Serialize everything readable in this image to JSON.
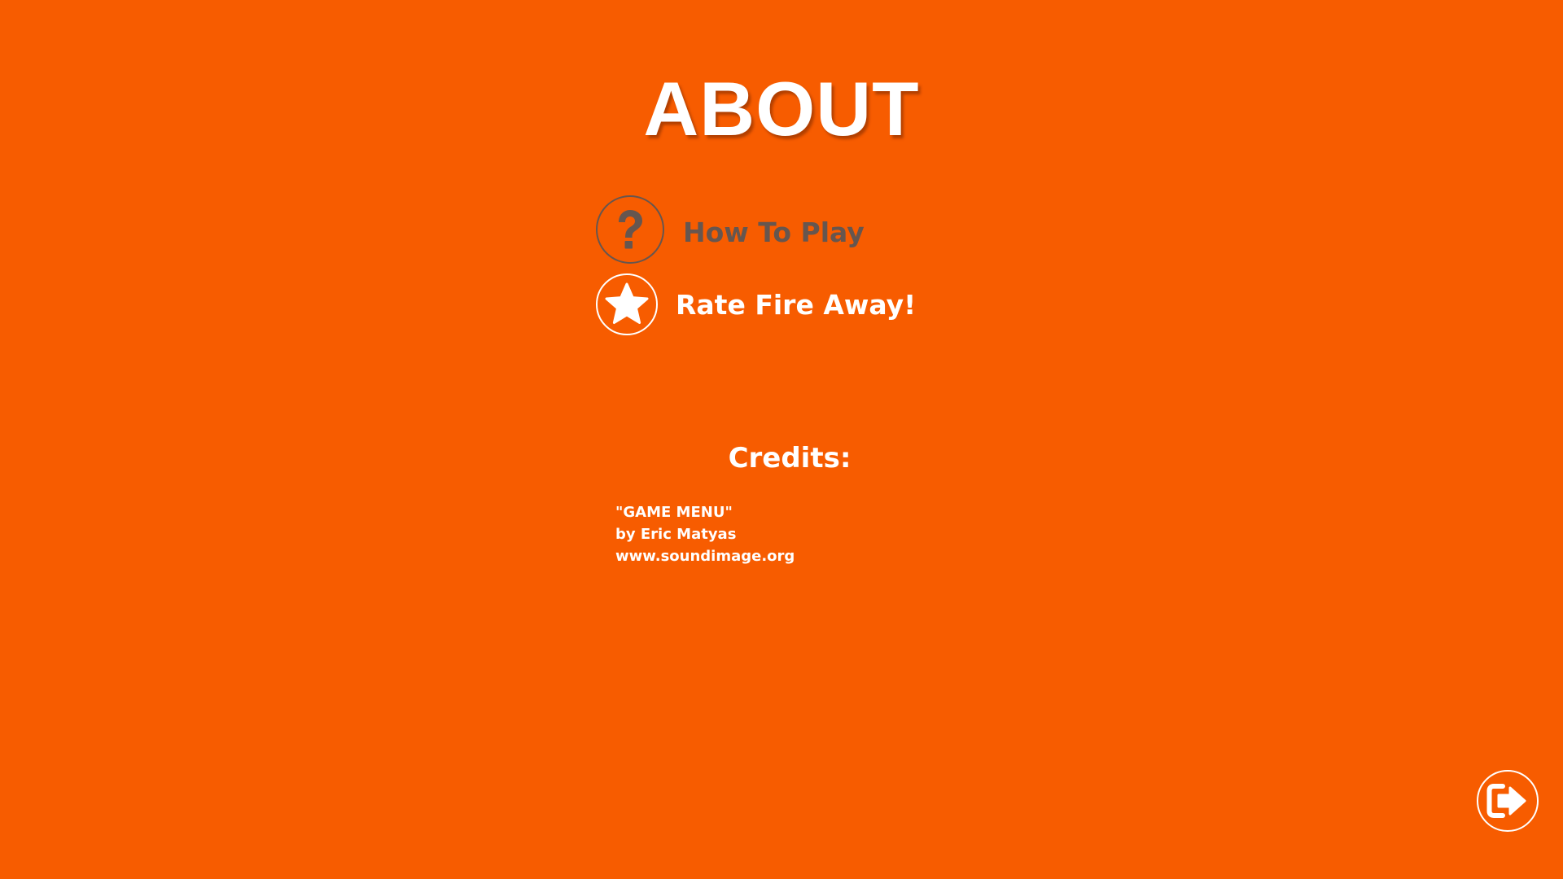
{
  "screen": {
    "title": "ABOUT",
    "background_color": "#f75c00"
  },
  "menu": {
    "how_to_play": {
      "label": "How To Play",
      "icon": "question-mark-icon",
      "color": "#66564f"
    },
    "rate": {
      "label": "Rate Fire Away!",
      "icon": "star-icon",
      "color": "#ffffff"
    }
  },
  "credits": {
    "heading": "Credits:",
    "lines": [
      "\"GAME MENU\"",
      "by Eric Matyas",
      "www.soundimage.org"
    ]
  },
  "exit_button": {
    "icon": "exit-arrow-icon"
  }
}
